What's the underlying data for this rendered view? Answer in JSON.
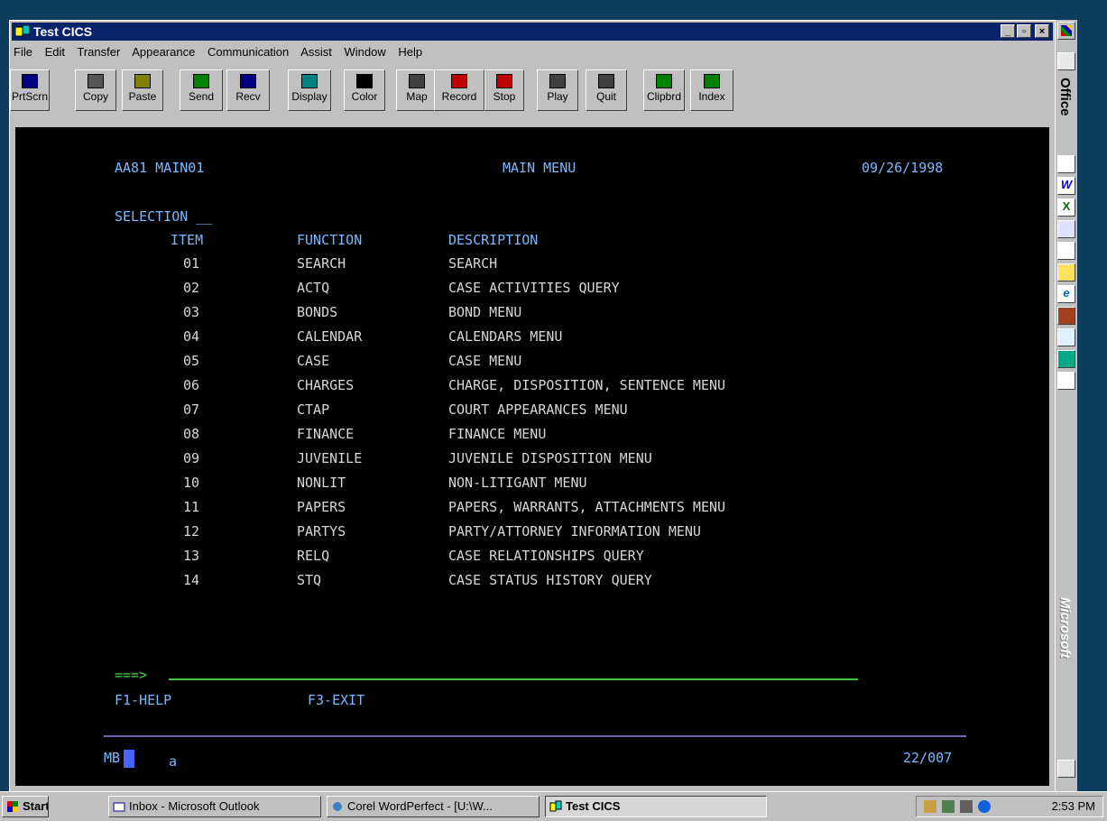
{
  "window": {
    "title": "Test CICS",
    "caption_buttons": [
      "_",
      "▫",
      "×"
    ]
  },
  "menu": [
    "File",
    "Edit",
    "Transfer",
    "Appearance",
    "Communication",
    "Assist",
    "Window",
    "Help"
  ],
  "toolbar": [
    {
      "label": "PrtScrn",
      "icon": "print-screen-icon",
      "color": "#000080"
    },
    {
      "label": "Copy",
      "icon": "copy-icon",
      "color": "#555555"
    },
    {
      "label": "Paste",
      "icon": "paste-icon",
      "color": "#808000"
    },
    {
      "label": "Send",
      "icon": "send-icon",
      "color": "#008000"
    },
    {
      "label": "Recv",
      "icon": "receive-icon",
      "color": "#000080"
    },
    {
      "label": "Display",
      "icon": "display-icon",
      "color": "#008080"
    },
    {
      "label": "Color",
      "icon": "color-icon",
      "color": "#000000"
    },
    {
      "label": "Map",
      "icon": "map-icon",
      "color": "#404040"
    },
    {
      "label": "Record",
      "icon": "record-icon",
      "color": "#c00000"
    },
    {
      "label": "Stop",
      "icon": "stop-icon",
      "color": "#c00000"
    },
    {
      "label": "Play",
      "icon": "play-icon",
      "color": "#404040"
    },
    {
      "label": "Quit",
      "icon": "quit-icon",
      "color": "#404040"
    },
    {
      "label": "Clipbrd",
      "icon": "clipboard-icon",
      "color": "#008000"
    },
    {
      "label": "Index",
      "icon": "index-icon",
      "color": "#008000"
    }
  ],
  "terminal": {
    "screen_id": "AA81 MAIN01",
    "heading": "MAIN MENU",
    "date": "09/26/1998",
    "selection_label": "SELECTION __",
    "columns": {
      "item": "ITEM",
      "function": "FUNCTION",
      "description": "DESCRIPTION"
    },
    "rows": [
      {
        "item": "01",
        "function": "SEARCH",
        "description": "SEARCH"
      },
      {
        "item": "02",
        "function": "ACTQ",
        "description": "CASE ACTIVITIES QUERY"
      },
      {
        "item": "03",
        "function": "BONDS",
        "description": "BOND MENU"
      },
      {
        "item": "04",
        "function": "CALENDAR",
        "description": "CALENDARS MENU"
      },
      {
        "item": "05",
        "function": "CASE",
        "description": "CASE MENU"
      },
      {
        "item": "06",
        "function": "CHARGES",
        "description": "CHARGE, DISPOSITION, SENTENCE MENU"
      },
      {
        "item": "07",
        "function": "CTAP",
        "description": "COURT APPEARANCES MENU"
      },
      {
        "item": "08",
        "function": "FINANCE",
        "description": "FINANCE MENU"
      },
      {
        "item": "09",
        "function": "JUVENILE",
        "description": "JUVENILE DISPOSITION MENU"
      },
      {
        "item": "10",
        "function": "NONLIT",
        "description": "NON-LITIGANT MENU"
      },
      {
        "item": "11",
        "function": "PAPERS",
        "description": "PAPERS, WARRANTS, ATTACHMENTS MENU"
      },
      {
        "item": "12",
        "function": "PARTYS",
        "description": "PARTY/ATTORNEY INFORMATION MENU"
      },
      {
        "item": "13",
        "function": "RELQ",
        "description": "CASE RELATIONSHIPS QUERY"
      },
      {
        "item": "14",
        "function": "STQ",
        "description": "CASE STATUS HISTORY QUERY"
      }
    ],
    "command_prompt": "===>",
    "command_value": "",
    "fkey_help": "F1-HELP",
    "fkey_exit": "F3-EXIT",
    "status_mode": "MB",
    "status_a": "a",
    "cursor_pos": "22/007"
  },
  "office_bar": {
    "top_text": "Office",
    "bottom_text": "Microsoft"
  },
  "taskbar": {
    "start": "Start",
    "tasks": [
      "Inbox - Microsoft Outlook",
      "Corel WordPerfect - [U:\\W...",
      "Test CICS"
    ],
    "clock": "2:53 PM"
  }
}
